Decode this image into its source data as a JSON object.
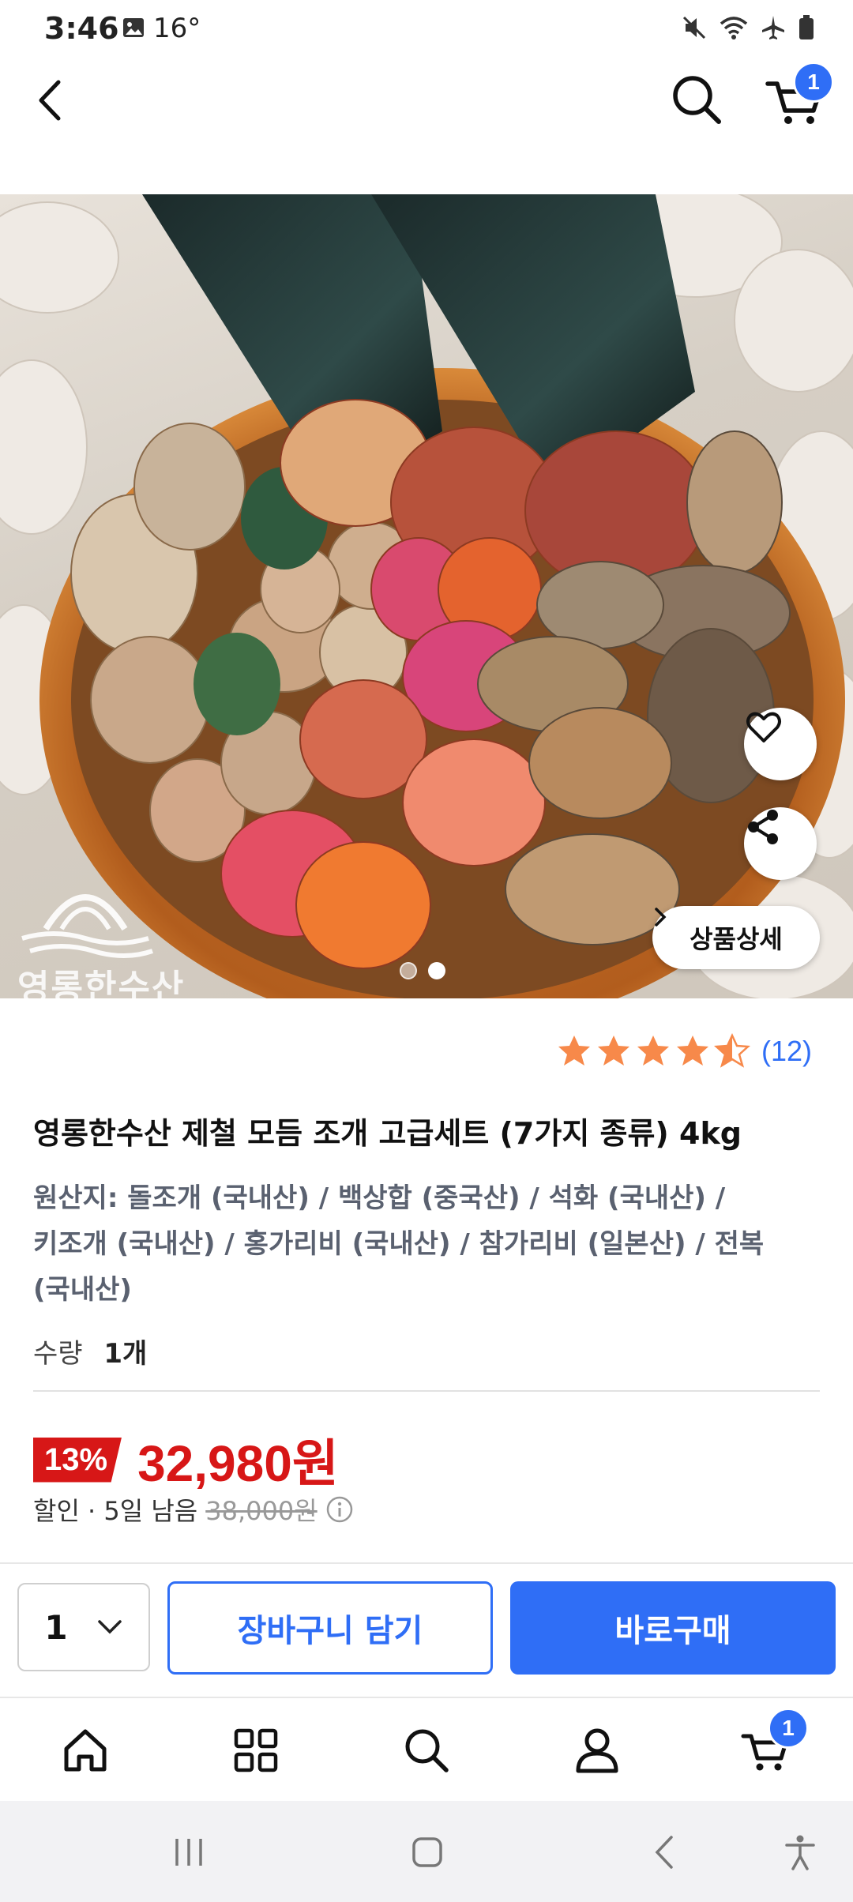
{
  "status_bar": {
    "time": "3:46",
    "temperature": "16°"
  },
  "header": {
    "cart_badge": "1"
  },
  "hero": {
    "brand_watermark": "영롱한수산",
    "detail_button": "상품상세",
    "page_index": 2,
    "page_count": 2
  },
  "product": {
    "rating_value": 4.5,
    "review_count": "(12)",
    "title": "영롱한수산 제철 모듬 조개 고급세트 (7가지 종류) 4kg",
    "origin_line1": "원산지: 돌조개 (국내산) / 백상합 (중국산) / 석화 (국내산) /",
    "origin_line2": "키조개 (국내산) / 홍가리비 (국내산) / 참가리비 (일본산) / 전복",
    "origin_line3": "(국내산)",
    "quantity_label": "수량",
    "quantity_value": "1개",
    "discount_rate": "13%",
    "price": "32,980원",
    "discount_label": "할인 · 5일 남음",
    "original_price": "38,000원"
  },
  "buy_bar": {
    "selected_qty": "1",
    "add_to_cart": "장바구니 담기",
    "buy_now": "바로구매"
  },
  "tab_bar": {
    "cart_badge": "1"
  },
  "colors": {
    "accent": "#2f6ef6",
    "sale_red": "#d71717",
    "star": "#f7894a"
  }
}
